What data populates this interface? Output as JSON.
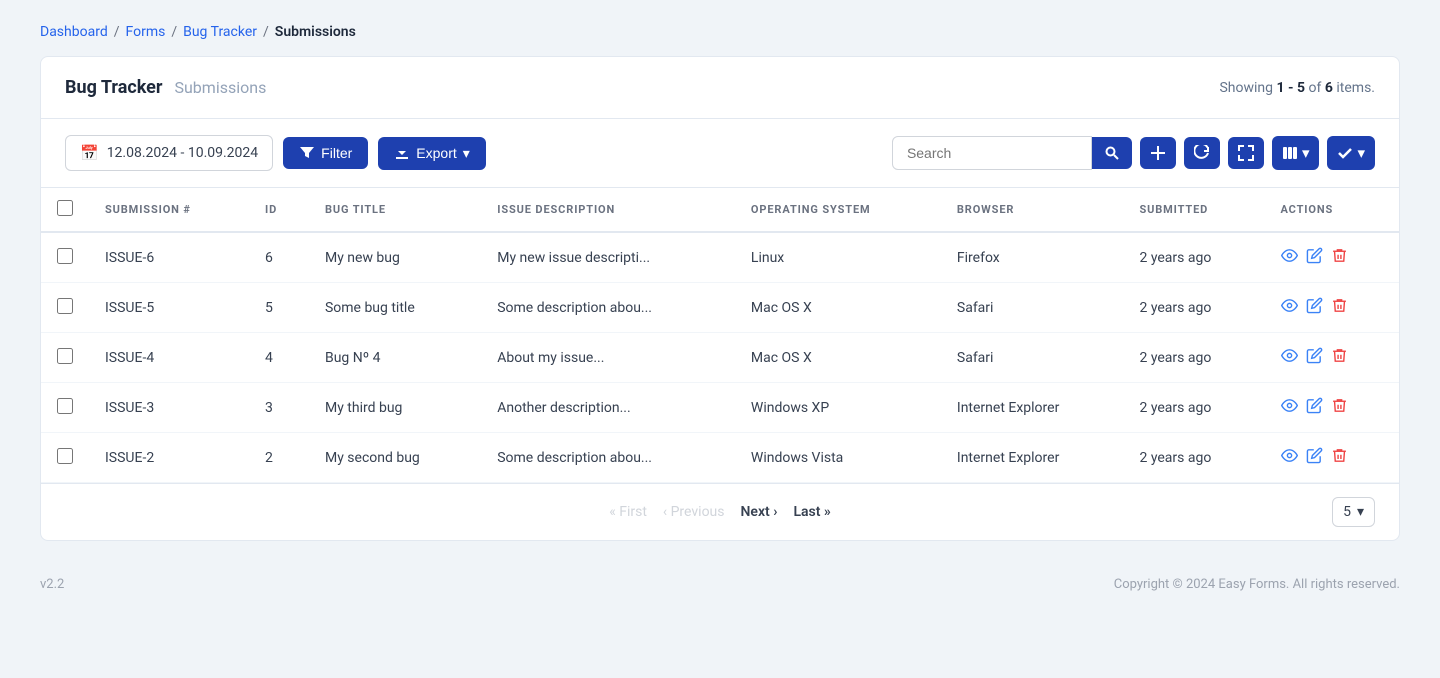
{
  "breadcrumb": {
    "items": [
      {
        "label": "Dashboard",
        "href": "#"
      },
      {
        "label": "Forms",
        "href": "#"
      },
      {
        "label": "Bug Tracker",
        "href": "#"
      },
      {
        "label": "Submissions",
        "href": null
      }
    ]
  },
  "header": {
    "title": "Bug Tracker",
    "subtitle": "Submissions",
    "meta_prefix": "Showing",
    "meta_range": "1 - 5",
    "meta_of": "of",
    "meta_total": "6",
    "meta_suffix": "items."
  },
  "toolbar": {
    "date_range": "12.08.2024 - 10.09.2024",
    "filter_label": "Filter",
    "export_label": "Export",
    "search_placeholder": "Search"
  },
  "table": {
    "columns": [
      {
        "key": "checkbox",
        "label": ""
      },
      {
        "key": "submission",
        "label": "Submission #"
      },
      {
        "key": "id",
        "label": "ID"
      },
      {
        "key": "bug_title",
        "label": "Bug Title"
      },
      {
        "key": "issue_description",
        "label": "Issue Description"
      },
      {
        "key": "operating_system",
        "label": "Operating System"
      },
      {
        "key": "browser",
        "label": "Browser"
      },
      {
        "key": "submitted",
        "label": "Submitted"
      },
      {
        "key": "actions",
        "label": "Actions"
      }
    ],
    "rows": [
      {
        "submission": "ISSUE-6",
        "id": "6",
        "bug_title": "My new bug",
        "issue_description": "My new issue descripti...",
        "operating_system": "Linux",
        "browser": "Firefox",
        "submitted": "2 years ago"
      },
      {
        "submission": "ISSUE-5",
        "id": "5",
        "bug_title": "Some bug title",
        "issue_description": "Some description abou...",
        "operating_system": "Mac OS X",
        "browser": "Safari",
        "submitted": "2 years ago"
      },
      {
        "submission": "ISSUE-4",
        "id": "4",
        "bug_title": "Bug Nº 4",
        "issue_description": "About my issue...",
        "operating_system": "Mac OS X",
        "browser": "Safari",
        "submitted": "2 years ago"
      },
      {
        "submission": "ISSUE-3",
        "id": "3",
        "bug_title": "My third bug",
        "issue_description": "Another description...",
        "operating_system": "Windows XP",
        "browser": "Internet Explorer",
        "submitted": "2 years ago"
      },
      {
        "submission": "ISSUE-2",
        "id": "2",
        "bug_title": "My second bug",
        "issue_description": "Some description abou...",
        "operating_system": "Windows Vista",
        "browser": "Internet Explorer",
        "submitted": "2 years ago"
      }
    ]
  },
  "pagination": {
    "first_label": "« First",
    "prev_label": "‹ Previous",
    "next_label": "Next ›",
    "last_label": "Last »",
    "per_page": "5"
  },
  "footer": {
    "version": "v2.2",
    "copyright": "Copyright © 2024 Easy Forms. All rights reserved."
  }
}
